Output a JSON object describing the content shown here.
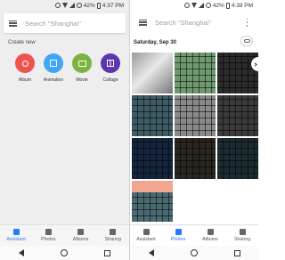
{
  "left": {
    "status": {
      "battery": "42%",
      "time": "4:37 PM"
    },
    "search": {
      "placeholder": "Search \"Shanghai\""
    },
    "create_new": {
      "heading": "Create new",
      "items": [
        {
          "label": "Album",
          "color": "#ef5350",
          "icon": "album-icon"
        },
        {
          "label": "Animation",
          "color": "#42a5f5",
          "icon": "animation-icon"
        },
        {
          "label": "Movie",
          "color": "#7cb342",
          "icon": "movie-icon"
        },
        {
          "label": "Collage",
          "color": "#5e35b1",
          "icon": "collage-icon"
        }
      ]
    },
    "nav": [
      {
        "label": "Assistant",
        "active": true
      },
      {
        "label": "Photos",
        "active": false
      },
      {
        "label": "Albums",
        "active": false
      },
      {
        "label": "Sharing",
        "active": false
      }
    ]
  },
  "right": {
    "status": {
      "battery": "42%",
      "time": "4:39 PM"
    },
    "search": {
      "placeholder": "Search \"Shanghai\""
    },
    "date_header": "Saturday, Sep 30",
    "photos": [
      {
        "tone": "#c9c9c9",
        "keys": false
      },
      {
        "tone": "#6f9a6f",
        "keys": true
      },
      {
        "tone": "#2b2b2b",
        "keys": true
      },
      {
        "tone": "#3e5b66",
        "keys": true
      },
      {
        "tone": "#8a8a8a",
        "keys": true
      },
      {
        "tone": "#3a3a3a",
        "keys": true
      },
      {
        "tone": "#14253d",
        "keys": true
      },
      {
        "tone": "#2a2520",
        "keys": true
      },
      {
        "tone": "#1c2b30",
        "keys": true
      },
      {
        "tone": "#4a6a72",
        "keys": true
      }
    ],
    "nav": [
      {
        "label": "Assistant",
        "active": false
      },
      {
        "label": "Photos",
        "active": true
      },
      {
        "label": "Albums",
        "active": false
      },
      {
        "label": "Sharing",
        "active": false
      }
    ]
  }
}
